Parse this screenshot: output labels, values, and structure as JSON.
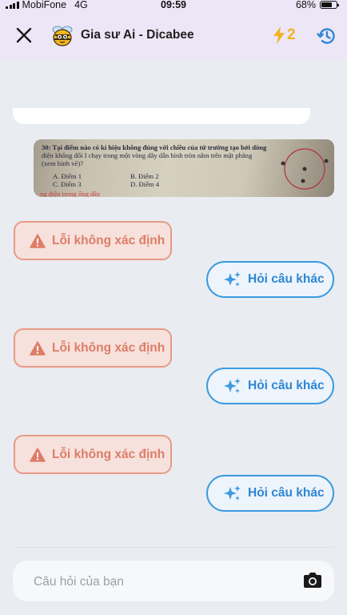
{
  "status_bar": {
    "carrier": "MobiFone",
    "network": "4G",
    "time": "09:59",
    "battery": "68%",
    "battery_level": 0.68
  },
  "header": {
    "title": "Gia sư Ai - Dicabee",
    "energy_count": "2",
    "accent_color": "#f0b323"
  },
  "question_image": {
    "text_line1": "30:  Tại điểm nào có kí hiệu không đúng với chiều của từ trường tạo bởi dòng",
    "text_line2": "điện không đổi I chạy trong một vòng dây dẫn hình tròn nằm trên mặt phẳng",
    "text_line3": "(xem hình vẽ)?",
    "option_a": "A. Điểm 1",
    "option_b": "B. Điểm 2",
    "option_c": "C. Điểm 3",
    "option_d": "D. Điểm 4",
    "footer_red": "ng điện trong ống dây"
  },
  "messages": [
    {
      "error_label": "Lỗi không xác định",
      "ask_label": "Hỏi câu khác"
    },
    {
      "error_label": "Lỗi không xác định",
      "ask_label": "Hỏi câu khác"
    },
    {
      "error_label": "Lỗi không xác định",
      "ask_label": "Hỏi câu khác"
    }
  ],
  "composer": {
    "placeholder": "Câu hỏi của bạn"
  },
  "colors": {
    "header_bg": "#ece6f7",
    "error": "#de7d67",
    "action": "#2e86d4"
  }
}
